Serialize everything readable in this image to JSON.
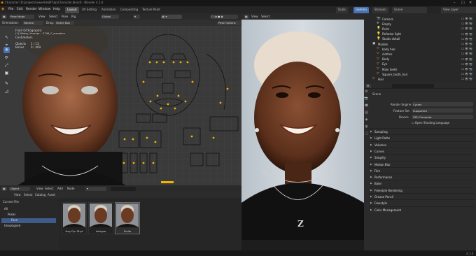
{
  "titlebar": {
    "title": "Character [D:\\projects\\sweetie\\Bfr\\Sp\\Character.blend] - Blender 4.1.0",
    "win_controls": [
      "–",
      "□",
      "✕"
    ]
  },
  "menubar": {
    "items": [
      "File",
      "Edit",
      "Render",
      "Window",
      "Help"
    ],
    "workspaces": [
      "Layout",
      "UV Editing",
      "Animation",
      "Compositing",
      "Texture Paint"
    ],
    "active_workspace": "Layout",
    "right": {
      "scene_label": "Scene",
      "view_layer": "View Layer",
      "btn1": "Scale",
      "btn2": "Gamma",
      "btn3": "Sharpen"
    }
  },
  "viewport": {
    "mode": "Pose Mode",
    "menus": [
      "View",
      "Select",
      "Pose",
      "Rig"
    ],
    "orientation_label": "Orientation:",
    "orientation": "Neutral",
    "drag_label": "Drag:",
    "drag": "Select Box",
    "transform": "Global",
    "pose_options": "Pose Options",
    "info_line1": "Front Orthographic",
    "info_line2": "(1) Wiring | face.ipr... 5746_C_armature",
    "info_line3": "Centimeters",
    "objects_label": "Objects",
    "objects_value": "1 / 13",
    "bones_label": "Bones",
    "bones_value": "0 / 409",
    "tools": [
      "↖",
      "⌖",
      "✥",
      "⟳",
      "⤢",
      "▣",
      "✎",
      "◿"
    ]
  },
  "render_view": {
    "mode": "Object Mode",
    "menus": [
      "View",
      "Select",
      "Add",
      "Object"
    ],
    "shading": "Scene",
    "necklace_letter": "Z"
  },
  "outliner": {
    "rows": [
      {
        "icon": "cam",
        "label": "Camera",
        "indent": 2
      },
      {
        "icon": "emp",
        "label": "Empty",
        "indent": 2
      },
      {
        "icon": "light",
        "label": "Point",
        "indent": 2
      },
      {
        "icon": "light",
        "label": "Refactor light",
        "indent": 2
      },
      {
        "icon": "light",
        "label": "Studio detail",
        "indent": 2
      },
      {
        "icon": "coll",
        "label": "Models",
        "indent": 1
      },
      {
        "icon": "obj",
        "label": "body hair",
        "indent": 2
      },
      {
        "icon": "obj",
        "label": "clothes",
        "indent": 2
      },
      {
        "icon": "obj",
        "label": "Body",
        "indent": 2
      },
      {
        "icon": "obj",
        "label": "Eye",
        "indent": 2
      },
      {
        "icon": "obj",
        "label": "Main teeth",
        "indent": 2
      },
      {
        "icon": "obj",
        "label": "Square_tooth_hair",
        "indent": 2
      },
      {
        "icon": "obj",
        "label": "Hair",
        "indent": 1
      }
    ]
  },
  "properties": {
    "search_placeholder": "",
    "scene_label": "Scene",
    "render_engine_label": "Render Engine",
    "render_engine": "Cycles",
    "feature_set_label": "Feature Set",
    "feature_set": "Supported",
    "device_label": "Device",
    "device": "GPU Compute",
    "osl_label": "Open Shading Language",
    "panels": [
      "Sampling",
      "Light Paths",
      "Volumes",
      "Curves",
      "Simplify",
      "Motion Blur",
      "Film",
      "Performance",
      "Bake",
      "Freestyle Rendering",
      "Grease Pencil",
      "Freestyle",
      "Color Management"
    ]
  },
  "asset_browser": {
    "mode": "Object",
    "menus": [
      "View",
      "Select",
      "Add",
      "Node"
    ],
    "second_menus": [
      "View",
      "Select",
      "Catalog",
      "Asset"
    ],
    "current_file": "Current File",
    "tree": [
      {
        "label": "All",
        "selected": false,
        "indent": 0
      },
      {
        "label": "Poses",
        "selected": false,
        "indent": 1
      },
      {
        "label": "Face",
        "selected": true,
        "indent": 2
      },
      {
        "label": "Unassigned",
        "selected": false,
        "indent": 0
      }
    ],
    "thumbnails": [
      {
        "label": "Hey Fyn Shyt",
        "selected": false
      },
      {
        "label": "Intrigue",
        "selected": false
      },
      {
        "label": "Smile",
        "selected": true
      }
    ],
    "search_placeholder": ""
  },
  "statusbar": {
    "version": "4.1.0"
  },
  "colors": {
    "accent": "#4772b3",
    "selected_row": "#3e5b8a",
    "bone_yellow": "#f0b400"
  }
}
